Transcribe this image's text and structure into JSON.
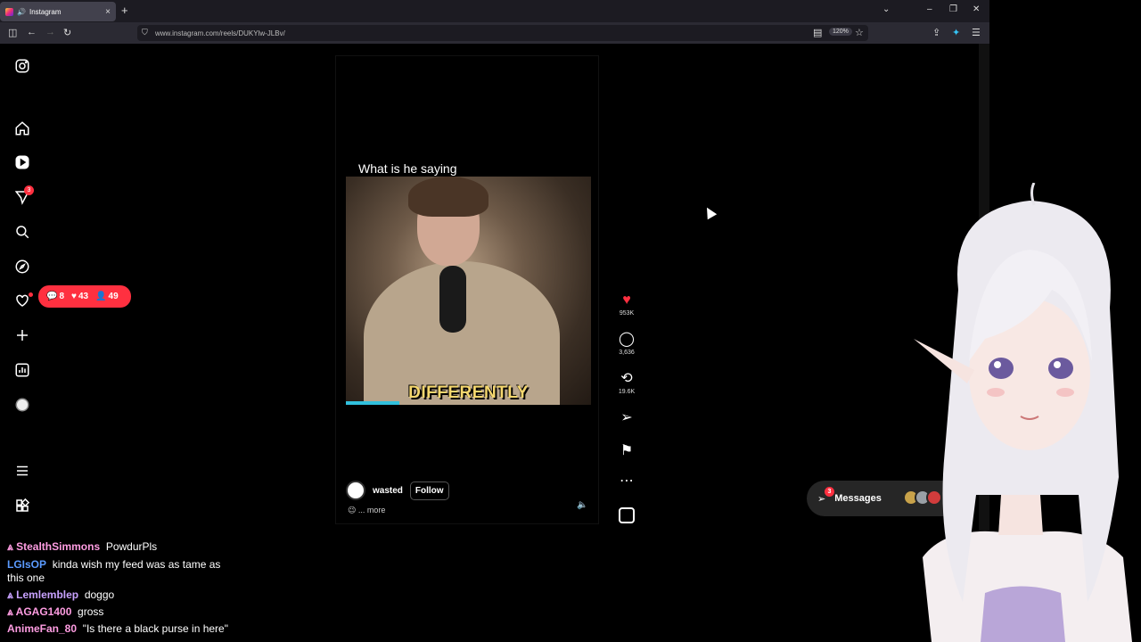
{
  "browser": {
    "tab_title": "Instagram",
    "new_tab": "+",
    "url": "www.instagram.com/reels/DUKYlw-JLBv/",
    "zoom": "120%",
    "win_min": "–",
    "win_restore": "❐",
    "win_close": "✕"
  },
  "sidebar": {
    "direct_badge": "3"
  },
  "notification_pill": {
    "comments": "8",
    "likes": "43",
    "follows": "49"
  },
  "reel": {
    "caption": "What is he saying",
    "subtitle": "DIFFERENTLY",
    "author": "wasted",
    "follow_label": "Follow",
    "description": "😉 ... more"
  },
  "actions": {
    "likes": "953K",
    "comments": "3,636",
    "reposts": "19.6K"
  },
  "messages": {
    "label": "Messages",
    "badge": "3"
  },
  "chat": [
    {
      "user": "StealthSimmons",
      "color": "#ff9de2",
      "text": "PowdurPls",
      "prefix": "⩓ "
    },
    {
      "user": "LGIsOP",
      "color": "#5b9bff",
      "text": "kinda wish my feed was as tame as",
      "prefix": ""
    },
    {
      "user": "",
      "color": "#fff",
      "text": "this one",
      "prefix": ""
    },
    {
      "user": "Lemlemblep",
      "color": "#c8a2ff",
      "text": "doggo",
      "prefix": "⩓ "
    },
    {
      "user": "AGAG1400",
      "color": "#ff9de2",
      "text": "gross",
      "prefix": "⩓ "
    },
    {
      "user": "AnimeFan_80",
      "color": "#ff9de2",
      "text": "\"Is there a black purse in here\"",
      "prefix": ""
    }
  ],
  "colors": {
    "accent": "#ff3040",
    "subtitle": "#f5d76e"
  }
}
